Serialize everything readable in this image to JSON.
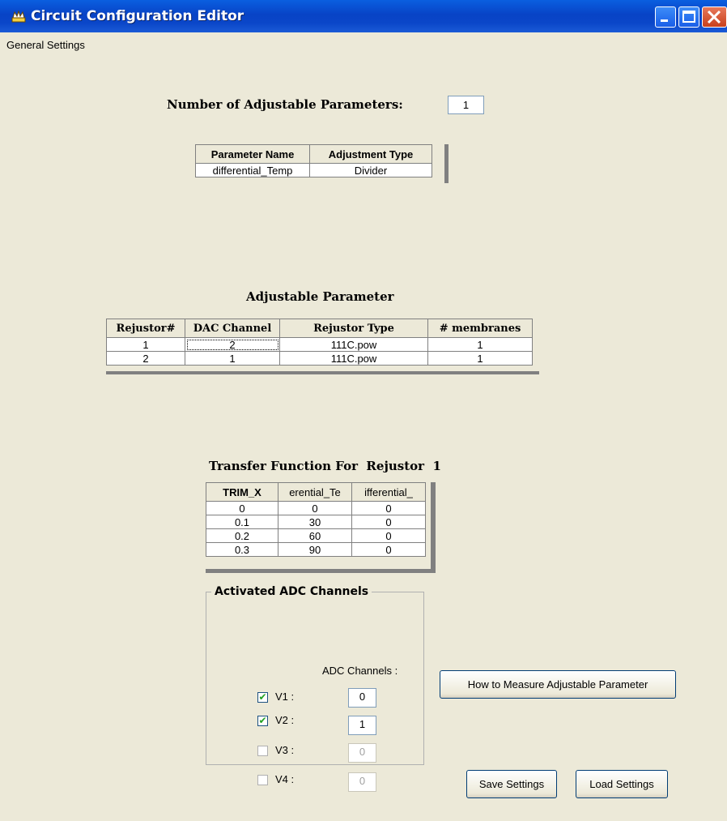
{
  "window": {
    "title": "Circuit Configuration Editor"
  },
  "menu": {
    "items": [
      "General Settings"
    ]
  },
  "num_params": {
    "label": "Number of Adjustable Parameters:",
    "value": "1"
  },
  "param_table": {
    "headers": [
      "Parameter Name",
      "Adjustment Type"
    ],
    "rows": [
      [
        "differential_Temp",
        "Divider"
      ]
    ]
  },
  "adj_param": {
    "title": "Adjustable Parameter",
    "headers": [
      "Rejustor#",
      "DAC Channel",
      "Rejustor Type",
      "# membranes"
    ],
    "rows": [
      [
        "1",
        "2",
        "111C.pow",
        "1"
      ],
      [
        "2",
        "1",
        "111C.pow",
        "1"
      ]
    ]
  },
  "transfer": {
    "title": "Transfer Function For  Rejustor  1",
    "headers": [
      "TRIM_X",
      "erential_Te",
      "ifferential_"
    ],
    "rows": [
      [
        "0",
        "0",
        "0"
      ],
      [
        "0.1",
        "30",
        "0"
      ],
      [
        "0.2",
        "60",
        "0"
      ],
      [
        "0.3",
        "90",
        "0"
      ]
    ]
  },
  "adc": {
    "legend": "Activated ADC Channels",
    "col_header": "ADC Channels :",
    "channels": [
      {
        "label": "V1 :",
        "checked": true,
        "value": "0"
      },
      {
        "label": "V2 :",
        "checked": true,
        "value": "1"
      },
      {
        "label": "V3 :",
        "checked": false,
        "value": "0"
      },
      {
        "label": "V4 :",
        "checked": false,
        "value": "0"
      }
    ]
  },
  "buttons": {
    "measure": "How to Measure Adjustable Parameter",
    "save": "Save Settings",
    "load": "Load Settings"
  }
}
